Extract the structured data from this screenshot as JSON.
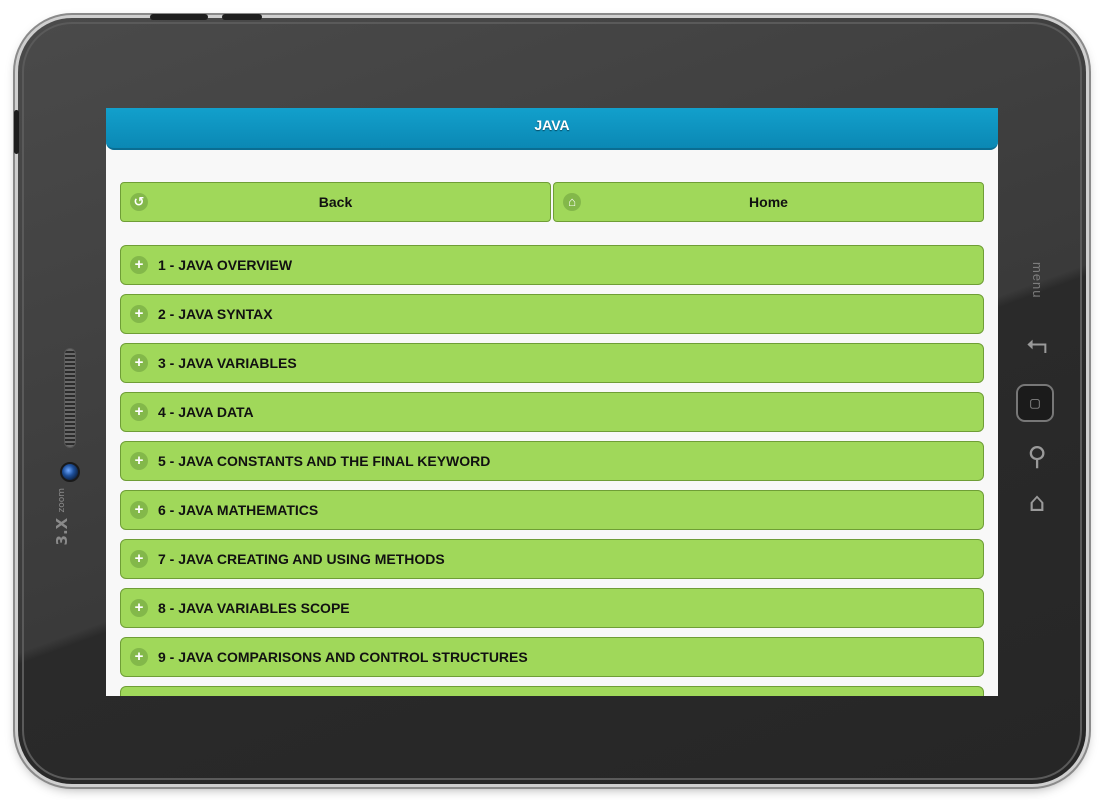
{
  "header": {
    "title": "JAVA"
  },
  "nav": {
    "back_label": "Back",
    "home_label": "Home"
  },
  "items": [
    {
      "label": "1 - JAVA OVERVIEW"
    },
    {
      "label": "2 - JAVA SYNTAX"
    },
    {
      "label": "3 - JAVA VARIABLES"
    },
    {
      "label": "4 - JAVA DATA"
    },
    {
      "label": "5 - JAVA CONSTANTS AND THE FINAL KEYWORD"
    },
    {
      "label": "6 - JAVA MATHEMATICS"
    },
    {
      "label": "7 - JAVA CREATING AND USING METHODS"
    },
    {
      "label": "8 - JAVA VARIABLES SCOPE"
    },
    {
      "label": "9 - JAVA COMPARISONS AND CONTROL STRUCTURES"
    },
    {
      "label": ""
    }
  ],
  "device": {
    "brand": "3.X",
    "brand_sub": "zoom",
    "menu_label": "menu"
  },
  "colors": {
    "header": "#0b88b4",
    "button": "#a0d85a",
    "button_border": "#6f9e36"
  }
}
